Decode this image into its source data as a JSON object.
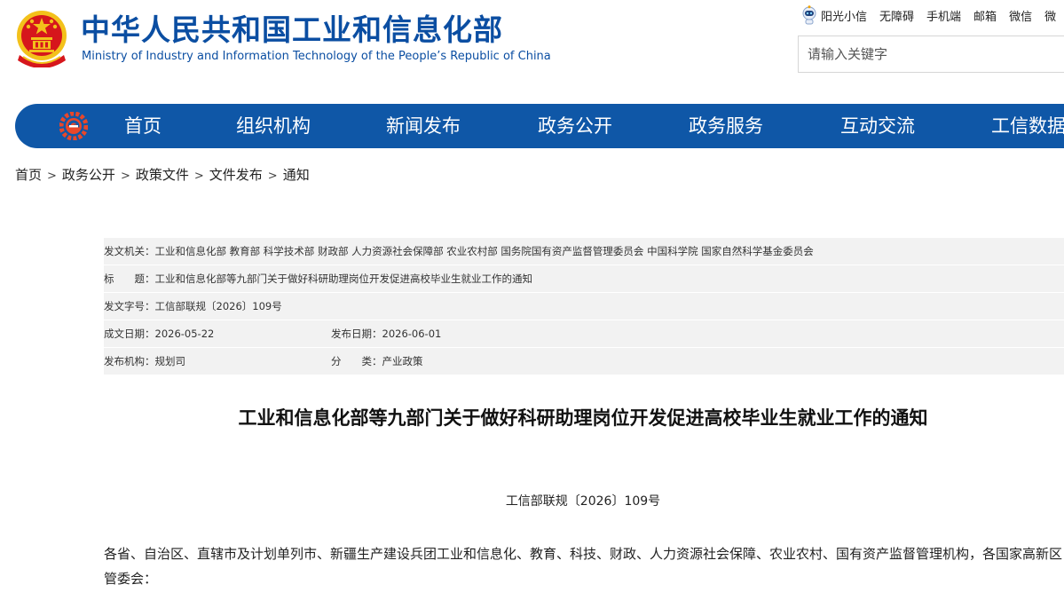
{
  "header": {
    "title": "中华人民共和国工业和信息化部",
    "subtitle": "Ministry of Industry and Information Technology of the People’s Republic of China"
  },
  "top_links": {
    "items": [
      "阳光小信",
      "无障碍",
      "手机端",
      "邮箱",
      "微信",
      "微"
    ]
  },
  "search": {
    "placeholder": "请输入关键字"
  },
  "nav": {
    "items": [
      "首页",
      "组织机构",
      "新闻发布",
      "政务公开",
      "政务服务",
      "互动交流",
      "工信数据"
    ]
  },
  "breadcrumb": {
    "items": [
      "首页",
      "政务公开",
      "政策文件",
      "文件发布",
      "通知"
    ],
    "separator": ">"
  },
  "info": {
    "issuer_label": "发文机关：",
    "issuer": "工业和信息化部 教育部 科学技术部 财政部 人力资源社会保障部 农业农村部 国务院国有资产监督管理委员会 中国科学院 国家自然科学基金委员会",
    "title_label": "标　　题：",
    "title": "工业和信息化部等九部门关于做好科研助理岗位开发促进高校毕业生就业工作的通知",
    "doc_no_label": "发文字号：",
    "doc_no": "工信部联规〔2026〕109号",
    "created_label": "成文日期：",
    "created": "2026-05-22",
    "published_label": "发布日期：",
    "published": "2026-06-01",
    "org_label": "发布机构：",
    "org": "规划司",
    "category_label": "分　　类：",
    "category": "产业政策"
  },
  "article": {
    "title": "工业和信息化部等九部门关于做好科研助理岗位开发促进高校毕业生就业工作的通知",
    "doc_number": "工信部联规〔2026〕109号",
    "paragraph": "各省、自治区、直辖市及计划单列市、新疆生产建设兵团工业和信息化、教育、科技、财政、人力资源社会保障、农业农村、国有资产监督管理机构，各国家高新区管委会："
  },
  "colors": {
    "brand_blue": "#0f57a7",
    "title_blue": "#0b4ea2",
    "emblem_red": "#d6161c",
    "emblem_gold": "#f3c11b",
    "info_bg": "#f2f2f2"
  }
}
